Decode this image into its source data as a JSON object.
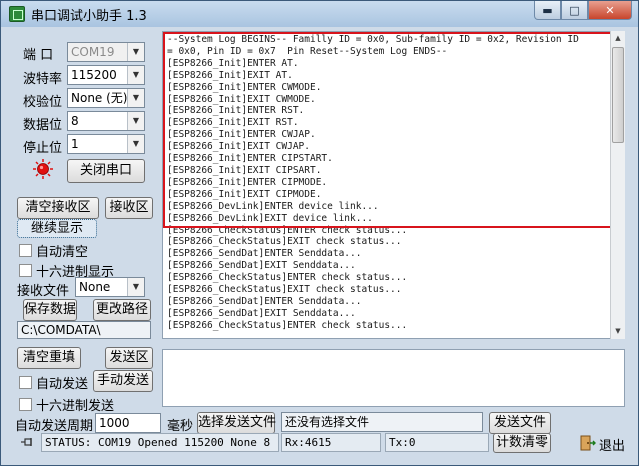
{
  "window": {
    "title": "串口调试小助手 1.3"
  },
  "serial": {
    "port_label": "端 口",
    "port_value": "COM19",
    "baud_label": "波特率",
    "baud_value": "115200",
    "parity_label": "校验位",
    "parity_value": "None (无)",
    "databits_label": "数据位",
    "databits_value": "8",
    "stopbits_label": "停止位",
    "stopbits_value": "1",
    "close_port_label": "关闭串口"
  },
  "receive": {
    "clear_label": "清空接收区",
    "recv_area_label": "接收区",
    "continue_label": "继续显示",
    "auto_clear_label": "自动清空",
    "hex_display_label": "十六进制显示",
    "recv_file_label": "接收文件",
    "recv_file_value": "None",
    "save_data_label": "保存数据",
    "change_path_label": "更改路径",
    "path_value": "C:\\COMDATA\\",
    "lines": [
      "--System Log BEGINS-- Familly ID = 0x0, Sub-family ID = 0x2, Revision ID",
      "= 0x0, Pin ID = 0x7  Pin Reset--System Log ENDS--",
      "[ESP8266_Init]ENTER AT.",
      "[ESP8266_Init]EXIT AT.",
      "[ESP8266_Init]ENTER CWMODE.",
      "[ESP8266_Init]EXIT CWMODE.",
      "[ESP8266_Init]ENTER RST.",
      "[ESP8266_Init]EXIT RST.",
      "[ESP8266_Init]ENTER CWJAP.",
      "[ESP8266_Init]EXIT CWJAP.",
      "[ESP8266_Init]ENTER CIPSTART.",
      "[ESP8266_Init]EXIT CIPSART.",
      "[ESP8266_Init]ENTER CIPMODE.",
      "[ESP8266_Init]EXIT CIPMODE.",
      "[ESP8266_DevLink]ENTER device link...",
      "[ESP8266_DevLink]EXIT device link...",
      "[ESP8266_CheckStatus]ENTER check status...",
      "[ESP8266_CheckStatus]EXIT check status...",
      "[ESP8266_SendDat]ENTER Senddata...",
      "[ESP8266_SendDat]EXIT Senddata...",
      "[ESP8266_CheckStatus]ENTER check status...",
      "[ESP8266_CheckStatus]EXIT check status...",
      "[ESP8266_SendDat]ENTER Senddata...",
      "[ESP8266_SendDat]EXIT Senddata...",
      "[ESP8266_CheckStatus]ENTER check status..."
    ]
  },
  "send": {
    "clear_resend_label": "清空重填",
    "send_area_label": "发送区",
    "auto_send_label": "自动发送",
    "manual_send_label": "手动发送",
    "hex_send_label": "十六进制发送",
    "period_label": "自动发送周期",
    "period_value": "1000",
    "ms_label": "毫秒",
    "choose_file_label": "选择发送文件",
    "file_status": "还没有选择文件",
    "send_file_label": "发送文件",
    "count_clear_label": "计数清零",
    "exit_label": "退出"
  },
  "status": {
    "text": "STATUS: COM19 Opened 115200 None  8  1",
    "rx": "Rx:4615",
    "tx": "Tx:0"
  },
  "colors": {
    "highlight": "#d8141c",
    "led": "#e01010"
  }
}
